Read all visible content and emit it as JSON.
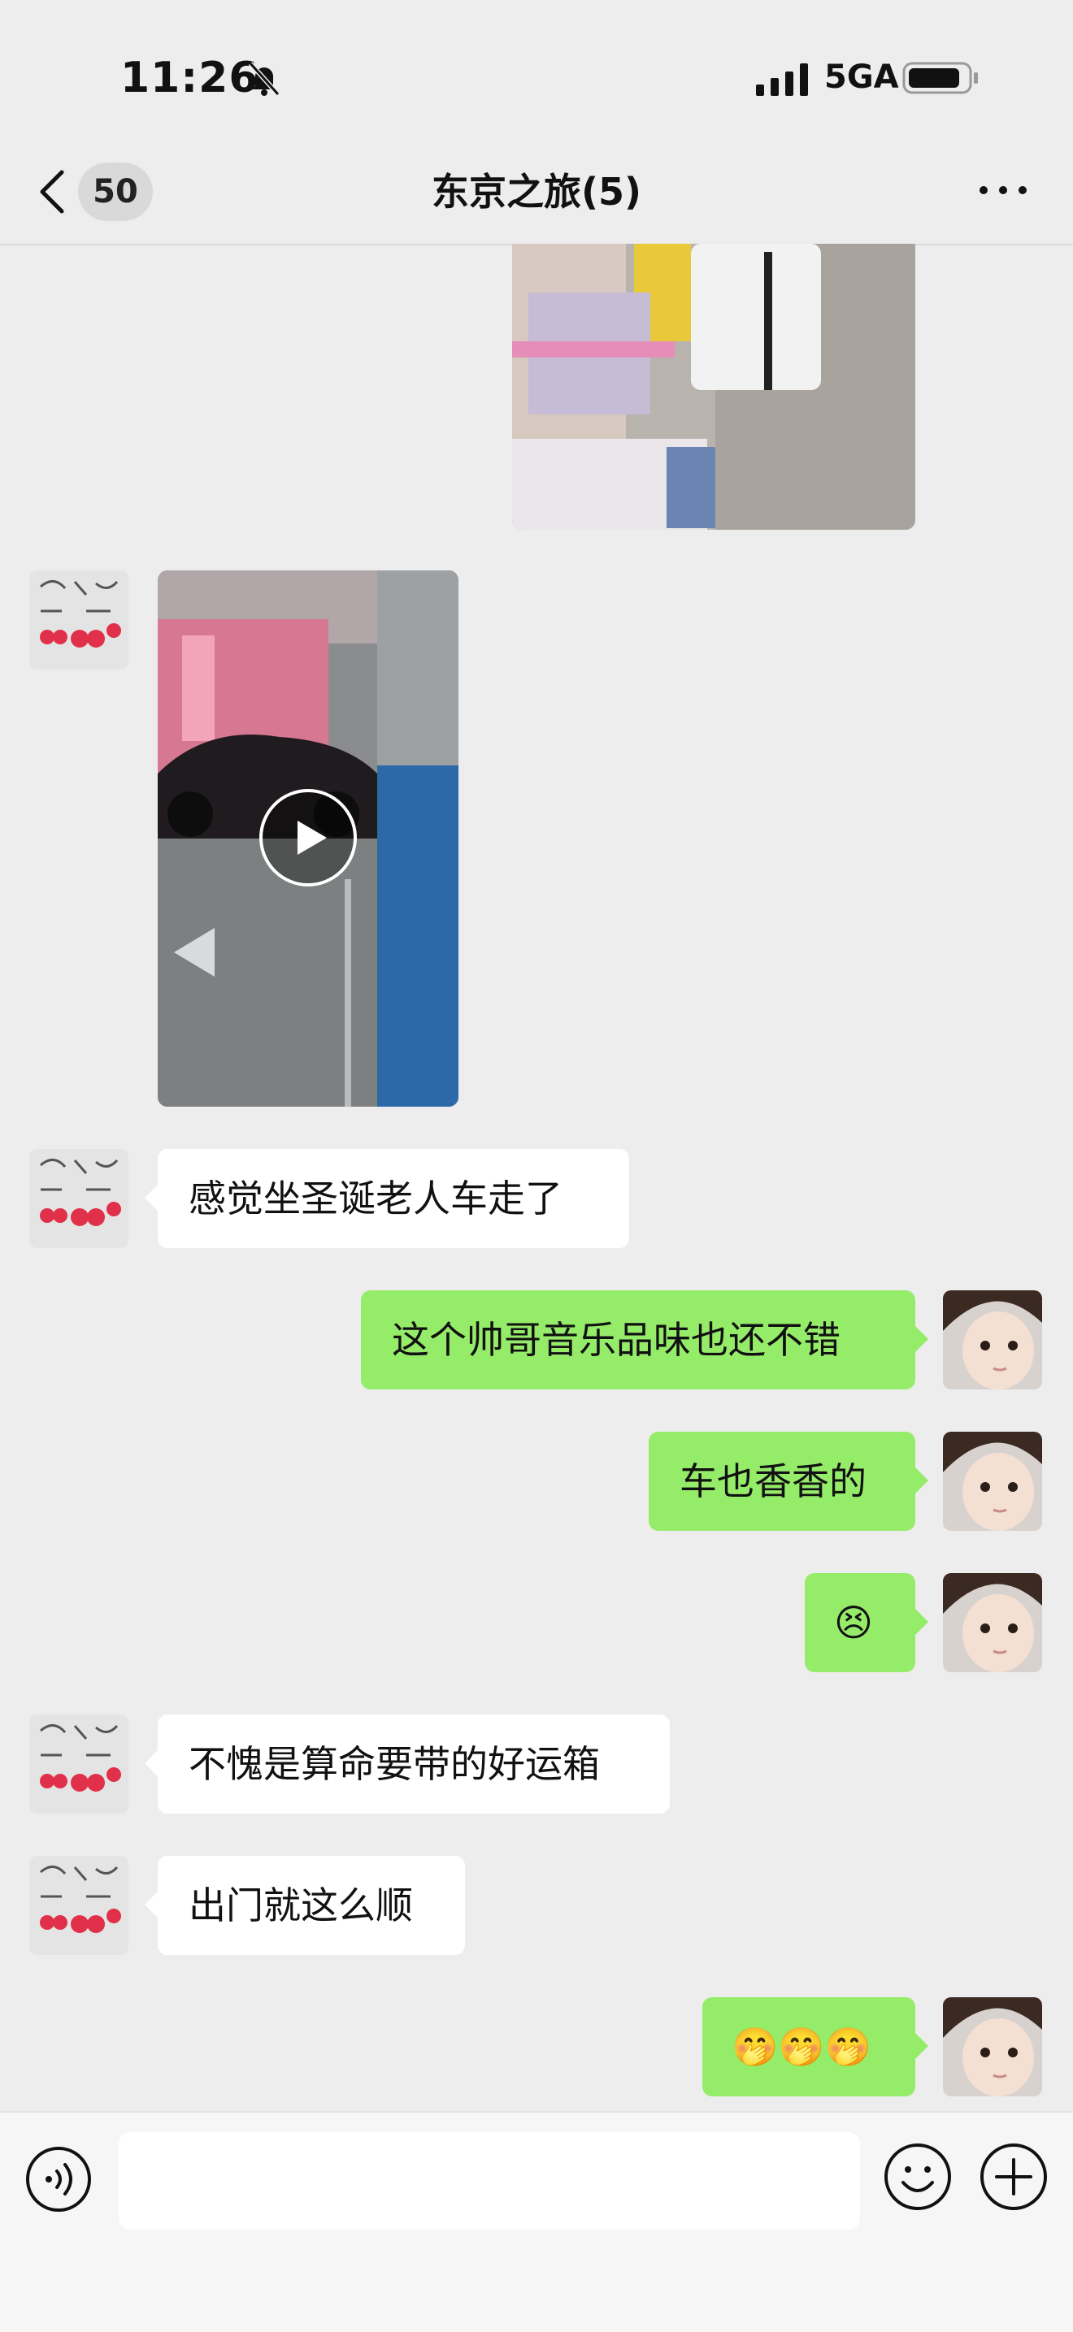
{
  "status_bar": {
    "time": "11:26",
    "network": "5GA"
  },
  "nav": {
    "unread_count": "50",
    "title": "东京之旅(5)"
  },
  "messages": [
    {
      "side": "in",
      "text": "感觉坐圣诞老人车走了"
    },
    {
      "side": "out",
      "text": "这个帅哥音乐品味也还不错"
    },
    {
      "side": "out",
      "text": "车也香香的"
    },
    {
      "side": "out",
      "text": "😣"
    },
    {
      "side": "in",
      "text": "不愧是算命要带的好运箱"
    },
    {
      "side": "in",
      "text": "出门就这么顺"
    },
    {
      "side": "out",
      "text": "🤭🤭🤭"
    }
  ],
  "icons": {
    "status": [
      "bell-mute-icon",
      "signal-icon",
      "battery-icon"
    ],
    "nav": [
      "back-icon",
      "more-icon"
    ],
    "media": [
      "play-icon"
    ],
    "input": [
      "voice-icon",
      "emoji-icon",
      "plus-icon"
    ]
  },
  "colors": {
    "background": "#ededed",
    "outgoing_bubble": "#95ec69",
    "incoming_bubble": "#ffffff"
  }
}
